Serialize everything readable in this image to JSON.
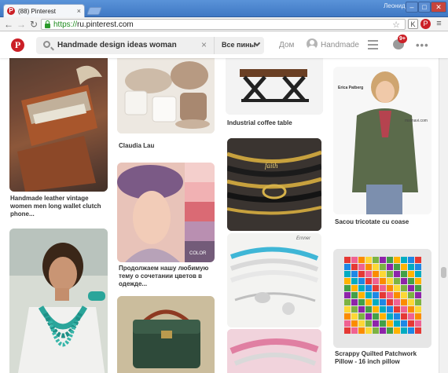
{
  "browser": {
    "tab_title": "(88) Pinterest",
    "tab_close": "×",
    "user_label": "Леонид",
    "url_scheme": "https://",
    "url_host": "ru.pinterest.com",
    "window_min": "–",
    "window_max": "□",
    "window_close": "✕"
  },
  "header": {
    "search_query": "Handmade design ideas woman",
    "search_clear": "×",
    "scope_label": "Все пины",
    "home_label": "Дом",
    "user_name": "Handmade",
    "notification_count": "9+",
    "more_label": "•••"
  },
  "pins": [
    {
      "caption": "Handmade leather vintage women men long wallet clutch phone..."
    },
    {
      "caption": "Claudia Lau"
    },
    {
      "caption": "Продолжаем нашу любимую тему о сочетании цветов в одежде..."
    },
    {
      "caption": "Industrial coffee table"
    },
    {
      "caption": "Sacou tricotate cu coase"
    },
    {
      "caption": "Scrappy Quilted Patchwork Pillow - 16 inch pillow"
    }
  ],
  "overlays": {
    "swatch_label": "COLOR",
    "bracelet_word": "faith",
    "bracelet_tag": "Ernner",
    "model_name": "Erica Patberg",
    "site_mark": "mslinavi.com"
  },
  "colors": {
    "brand": "#cb2027",
    "accent_green": "#1e8c1e"
  }
}
